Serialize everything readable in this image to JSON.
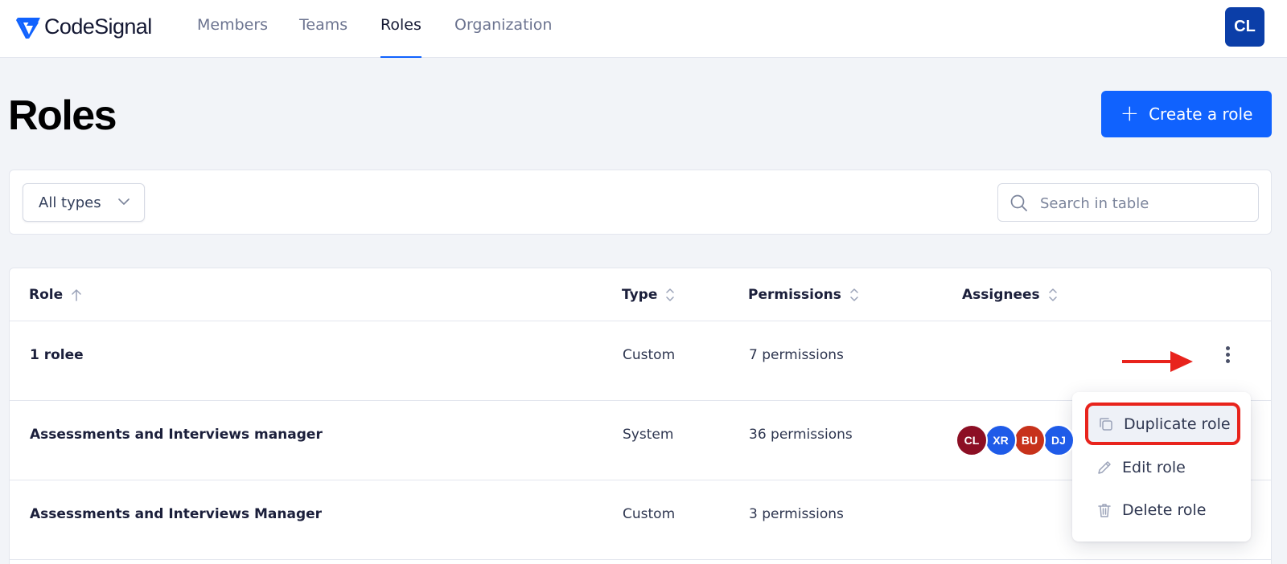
{
  "app": {
    "brand": "CodeSignal",
    "user_initials": "CL"
  },
  "nav": [
    {
      "label": "Members",
      "active": false
    },
    {
      "label": "Teams",
      "active": false
    },
    {
      "label": "Roles",
      "active": true
    },
    {
      "label": "Organization",
      "active": false
    }
  ],
  "page": {
    "title": "Roles",
    "create_button": "Create a role"
  },
  "filters": {
    "type_select": "All types",
    "search_placeholder": "Search in table"
  },
  "table": {
    "columns": [
      "Role",
      "Type",
      "Permissions",
      "Assignees"
    ],
    "rows": [
      {
        "role": "1 rolee",
        "type": "Custom",
        "permissions": "7 permissions"
      },
      {
        "role": "Assessments and Interviews manager",
        "type": "System",
        "permissions": "36 permissions",
        "assignees": [
          "CL",
          "XR",
          "BU",
          "DJ"
        ]
      },
      {
        "role": "Assessments and Interviews Manager",
        "type": "Custom",
        "permissions": "3 permissions"
      }
    ]
  },
  "menu": {
    "items": [
      {
        "label": "Duplicate role",
        "icon": "copy-icon"
      },
      {
        "label": "Edit role",
        "icon": "pencil-icon"
      },
      {
        "label": "Delete role",
        "icon": "trash-icon"
      }
    ]
  },
  "colors": {
    "accent": "#1062fe",
    "annotation": "#e8231c",
    "avatar_cl": "#8c0f24",
    "avatar_xr": "#1f5be8",
    "avatar_bu": "#c7321b",
    "avatar_dj": "#1f5be8"
  }
}
